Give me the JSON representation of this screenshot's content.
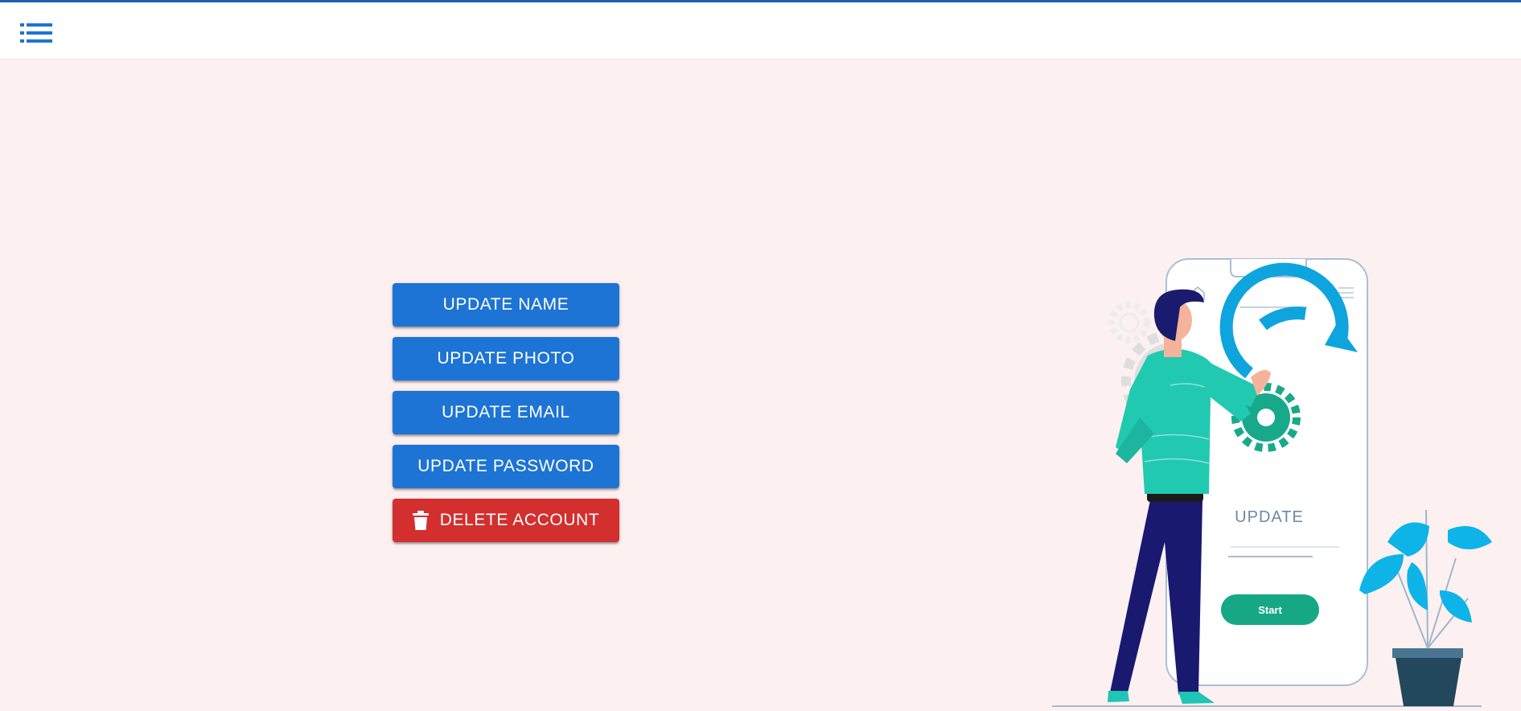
{
  "header": {
    "menu_icon": "list-menu-icon",
    "accent_color": "#1f5fae"
  },
  "actions": {
    "update_name": "UPDATE NAME",
    "update_photo": "UPDATE PHOTO",
    "update_email": "UPDATE EMAIL",
    "update_password": "UPDATE PASSWORD",
    "delete_account": "DELETE ACCOUNT",
    "delete_icon": "trash-icon",
    "primary_color": "#1d74d4",
    "danger_color": "#d32f2f"
  },
  "illustration": {
    "phone_title": "UPDATE",
    "start_button": "Start"
  }
}
